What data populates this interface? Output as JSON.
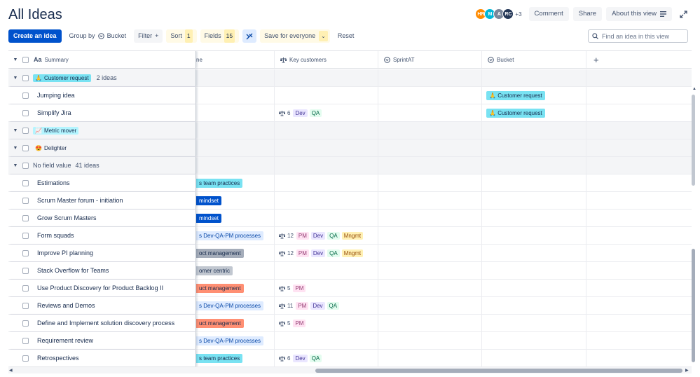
{
  "page": {
    "title": "All Ideas"
  },
  "top_right": {
    "avatars": [
      {
        "initials": "HR",
        "color": "#ff8b00"
      },
      {
        "initials": "M",
        "color": "#00b8d9"
      },
      {
        "initials": "A",
        "color": "#7a869a"
      },
      {
        "initials": "RC",
        "color": "#253858"
      }
    ],
    "more": "+3",
    "comment": "Comment",
    "share": "Share",
    "about": "About this view"
  },
  "toolbar": {
    "create": "Create an idea",
    "group_by": "Group by",
    "group_by_value": "Bucket",
    "filter": "Filter",
    "filter_icon": "+",
    "sort": "Sort",
    "sort_count": "1",
    "fields": "Fields",
    "fields_count": "15",
    "save": "Save for everyone",
    "reset": "Reset"
  },
  "search": {
    "placeholder": "Find an idea in this view"
  },
  "columns": {
    "summary": "Summary",
    "theme_fragment": "ne",
    "key_customers": "Key customers",
    "sprint": "SprintAT",
    "bucket": "Bucket"
  },
  "groups": {
    "customer_request": {
      "label": "Customer request",
      "count": "2 ideas"
    },
    "metric_mover": {
      "label": "Metric mover"
    },
    "delighter": {
      "label": "Delighter"
    },
    "no_value": {
      "label": "No field value",
      "count": "41 ideas"
    }
  },
  "rows": [
    {
      "title": "Jumping idea",
      "bucket": "Customer request"
    },
    {
      "title": "Simplify Jira",
      "customers": "6",
      "tags": [
        "Dev",
        "QA"
      ],
      "bucket": "Customer request"
    },
    {
      "title": "Estimations",
      "theme": "s team practices"
    },
    {
      "title": "Scrum Master forum - initiation",
      "theme": "mindset"
    },
    {
      "title": "Grow Scrum Masters",
      "theme": "mindset"
    },
    {
      "title": "Form squads",
      "theme": "s Dev-QA-PM processes",
      "customers": "12",
      "tags": [
        "PM",
        "Dev",
        "QA",
        "Mngmt"
      ]
    },
    {
      "title": "Improve PI planning",
      "theme": "oct management",
      "customers": "12",
      "tags": [
        "PM",
        "Dev",
        "QA",
        "Mngmt"
      ]
    },
    {
      "title": "Stack Overflow for Teams",
      "theme": "omer centric"
    },
    {
      "title": "Use Product Discovery for Product Backlog II",
      "theme": "uct management",
      "customers": "5",
      "tags": [
        "PM"
      ]
    },
    {
      "title": "Reviews and Demos",
      "theme": "s Dev-QA-PM processes",
      "customers": "11",
      "tags": [
        "PM",
        "Dev",
        "QA"
      ]
    },
    {
      "title": "Define and Implement solution discovery process",
      "theme": "uct management",
      "customers": "5",
      "tags": [
        "PM"
      ]
    },
    {
      "title": "Requirement review",
      "theme": "s Dev-QA-PM processes"
    },
    {
      "title": "Retrospectives",
      "theme": "s team practices",
      "customers": "6",
      "tags": [
        "Dev",
        "QA"
      ]
    }
  ]
}
